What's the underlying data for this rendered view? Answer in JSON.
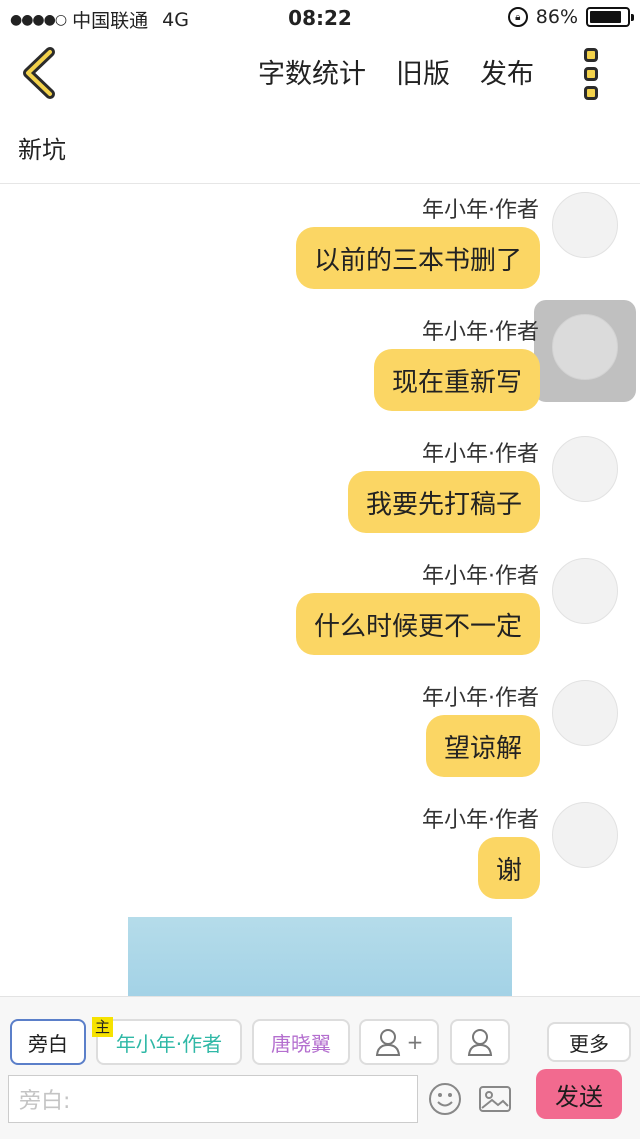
{
  "status_bar": {
    "signal": "●●●●○",
    "carrier": "中国联通",
    "network": "4G",
    "time": "08:22",
    "battery": "86%",
    "battery_level": 0.86
  },
  "nav": {
    "links": [
      "字数统计",
      "旧版",
      "发布"
    ]
  },
  "story_title": "新坑",
  "messages": [
    {
      "author": "年小年·作者",
      "text": "以前的三本书删了"
    },
    {
      "author": "年小年·作者",
      "text": "现在重新写"
    },
    {
      "author": "年小年·作者",
      "text": "我要先打稿子"
    },
    {
      "author": "年小年·作者",
      "text": "什么时候更不一定"
    },
    {
      "author": "年小年·作者",
      "text": "望谅解"
    },
    {
      "author": "年小年·作者",
      "text": "谢"
    }
  ],
  "toolbar": {
    "narration": "旁白",
    "master_badge": "主",
    "author_role": "年小年·作者",
    "character_role": "唐晓翼",
    "add_role_symbol": "+",
    "more": "更多",
    "input_placeholder": "旁白:",
    "send": "发送"
  },
  "colors": {
    "bubble": "#fbd664",
    "send": "#f26a8f",
    "author_role": "#2fb8a6",
    "character_role": "#b46fcf"
  }
}
